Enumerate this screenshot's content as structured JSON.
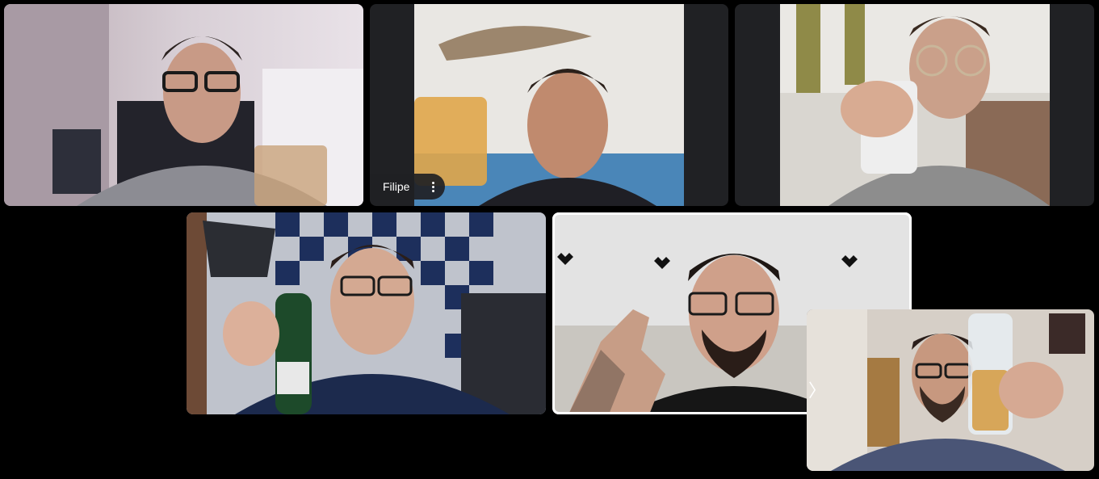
{
  "participants": [
    {
      "id": "t1",
      "name": ""
    },
    {
      "id": "t2",
      "name": "Filipe"
    },
    {
      "id": "t3",
      "name": ""
    },
    {
      "id": "t4",
      "name": ""
    },
    {
      "id": "t5",
      "name": "",
      "active_speaker": true
    }
  ],
  "self_view": {
    "name": ""
  },
  "controls": {
    "more_options_icon": "more-vert-icon",
    "expand_icon": "chevron-right-icon",
    "expand_glyph": "〉"
  },
  "colors": {
    "background": "#000000",
    "tile_background": "#202124",
    "active_speaker_border": "#ffffff"
  }
}
